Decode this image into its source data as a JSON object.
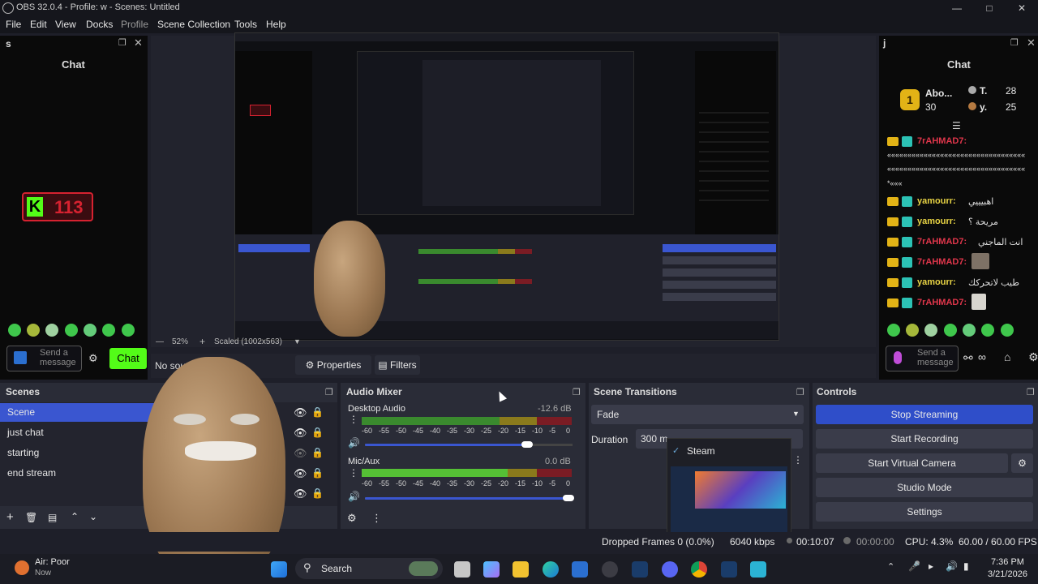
{
  "window": {
    "title": "OBS 32.0.4 - Profile: w - Scenes: Untitled"
  },
  "menu": [
    "File",
    "Edit",
    "View",
    "Docks",
    "Profile",
    "Scene Collection",
    "Tools",
    "Help"
  ],
  "left_dock": {
    "name": "s",
    "chat_title": "Chat",
    "kick_count": "113",
    "send_placeholder": "Send a message",
    "chat_button": "Chat"
  },
  "right_dock": {
    "name": "j",
    "chat_title": "Chat",
    "top_user": "Abo...",
    "top_user_score": "30",
    "top1_name": "T.",
    "top1_score": "28",
    "top2_name": "y.",
    "top2_score": "25",
    "messages": [
      {
        "user": "7rAHMAD7:",
        "text": "",
        "color": "#e0364b"
      },
      {
        "user": "",
        "text": "«««««««««««««««««««««««««««««««««««««««««««««««««««",
        "color": "#e0e0e0"
      },
      {
        "user": "",
        "text": "*«««",
        "color": "#e0e0e0"
      },
      {
        "user": "yamourr:",
        "text": "اهبيييي",
        "color": "#e8d344"
      },
      {
        "user": "yamourr:",
        "text": "مريحة ؟",
        "color": "#e8d344"
      },
      {
        "user": "7rAHMAD7:",
        "text": "انت الماجني",
        "color": "#e0364b"
      },
      {
        "user": "7rAHMAD7:",
        "text": "",
        "color": "#e0364b"
      },
      {
        "user": "yamourr:",
        "text": "طيب لاتحركك",
        "color": "#e8d344"
      },
      {
        "user": "7rAHMAD7:",
        "text": "",
        "color": "#e0364b"
      }
    ],
    "send_placeholder": "Send a message"
  },
  "preview": {
    "no_source": "No source selected",
    "properties": "Properties",
    "filters": "Filters"
  },
  "scenes": {
    "title": "Scenes",
    "items": [
      "Scene",
      "just chat",
      "starting",
      "end stream"
    ],
    "selected": 0
  },
  "audio_mixer": {
    "title": "Audio Mixer",
    "channels": [
      {
        "name": "Desktop Audio",
        "db": "-12.6 dB",
        "level": 0.83,
        "volume": 0.78
      },
      {
        "name": "Mic/Aux",
        "db": "0.0 dB",
        "level": 0.7,
        "volume": 0.98
      }
    ],
    "ticks": [
      "-60",
      "-55",
      "-50",
      "-45",
      "-40",
      "-35",
      "-30",
      "-25",
      "-20",
      "-15",
      "-10",
      "-5",
      "0"
    ]
  },
  "scene_transitions": {
    "title": "Scene Transitions",
    "transition": "Fade",
    "duration_label": "Duration",
    "duration_value": "300 m",
    "steam_popup": "Steam"
  },
  "controls": {
    "title": "Controls",
    "buttons": [
      "Stop Streaming",
      "Start Recording",
      "Start Virtual Camera",
      "Studio Mode",
      "Settings"
    ]
  },
  "status": {
    "dropped": "Dropped Frames 0 (0.0%)",
    "bitrate": "6040 kbps",
    "stream_time": "00:10:07",
    "rec_time": "00:00:00",
    "cpu": "CPU: 4.3%",
    "fps": "60.00 / 60.00 FPS"
  },
  "taskbar": {
    "weather_title": "Air: Poor",
    "weather_sub": "Now",
    "search": "Search",
    "time": "7:36 PM",
    "date": "3/21/2026"
  },
  "colors": {
    "accent": "#3a56d0",
    "kick_green": "#53fc18",
    "kick_red": "#d62230"
  }
}
